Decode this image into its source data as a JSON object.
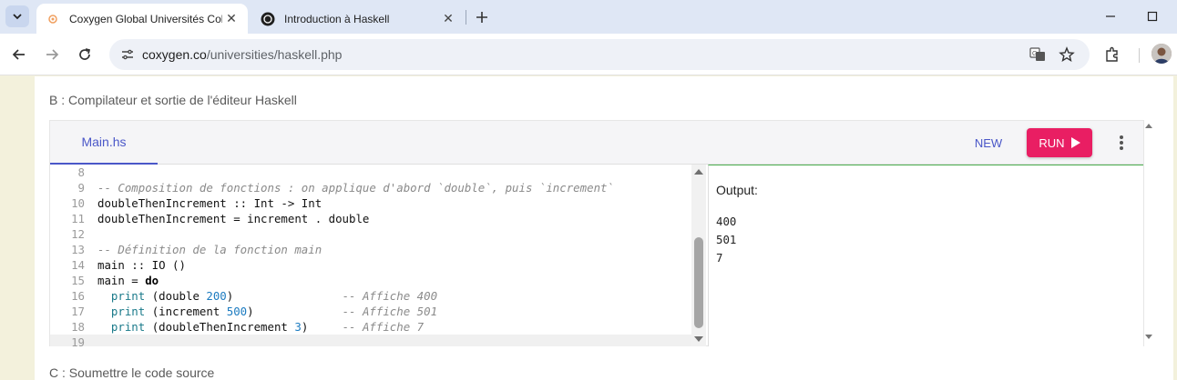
{
  "browser": {
    "tabs": [
      {
        "title": "Coxygen Global Universités Col",
        "active": true
      },
      {
        "title": "Introduction à Haskell",
        "active": false
      }
    ],
    "url_host": "coxygen.co",
    "url_path": "/universities/haskell.php"
  },
  "page": {
    "section_b_title": "B : Compilateur et sortie de l'éditeur Haskell",
    "section_c_title": "C : Soumettre le code source"
  },
  "editor": {
    "file_tab": "Main.hs",
    "new_label": "NEW",
    "run_label": "RUN",
    "accent_color": "#e91e63",
    "tab_color": "#4a57c8",
    "lines": [
      {
        "n": "8",
        "tokens": []
      },
      {
        "n": "9",
        "tokens": [
          {
            "t": "cmt",
            "v": "-- Composition de fonctions : on applique d'abord `double`, puis `increment`"
          }
        ]
      },
      {
        "n": "10",
        "tokens": [
          {
            "t": "txt",
            "v": "doubleThenIncrement :: Int -> Int"
          }
        ]
      },
      {
        "n": "11",
        "tokens": [
          {
            "t": "txt",
            "v": "doubleThenIncrement = increment . double"
          }
        ]
      },
      {
        "n": "12",
        "tokens": []
      },
      {
        "n": "13",
        "tokens": [
          {
            "t": "cmt",
            "v": "-- Définition de la fonction main"
          }
        ]
      },
      {
        "n": "14",
        "tokens": [
          {
            "t": "txt",
            "v": "main :: IO ()"
          }
        ]
      },
      {
        "n": "15",
        "tokens": [
          {
            "t": "txt",
            "v": "main = "
          },
          {
            "t": "kw",
            "v": "do"
          }
        ]
      },
      {
        "n": "16",
        "tokens": [
          {
            "t": "txt",
            "v": "  "
          },
          {
            "t": "fn",
            "v": "print"
          },
          {
            "t": "txt",
            "v": " (double "
          },
          {
            "t": "num",
            "v": "200"
          },
          {
            "t": "txt",
            "v": ")                "
          },
          {
            "t": "cmt",
            "v": "-- Affiche 400"
          }
        ]
      },
      {
        "n": "17",
        "tokens": [
          {
            "t": "txt",
            "v": "  "
          },
          {
            "t": "fn",
            "v": "print"
          },
          {
            "t": "txt",
            "v": " (increment "
          },
          {
            "t": "num",
            "v": "500"
          },
          {
            "t": "txt",
            "v": ")             "
          },
          {
            "t": "cmt",
            "v": "-- Affiche 501"
          }
        ]
      },
      {
        "n": "18",
        "tokens": [
          {
            "t": "txt",
            "v": "  "
          },
          {
            "t": "fn",
            "v": "print"
          },
          {
            "t": "txt",
            "v": " (doubleThenIncrement "
          },
          {
            "t": "num",
            "v": "3"
          },
          {
            "t": "txt",
            "v": ")     "
          },
          {
            "t": "cmt",
            "v": "-- Affiche 7"
          }
        ]
      },
      {
        "n": "19",
        "tokens": [],
        "current": true
      }
    ]
  },
  "output": {
    "label": "Output:",
    "lines": [
      "400",
      "501",
      "7"
    ]
  }
}
